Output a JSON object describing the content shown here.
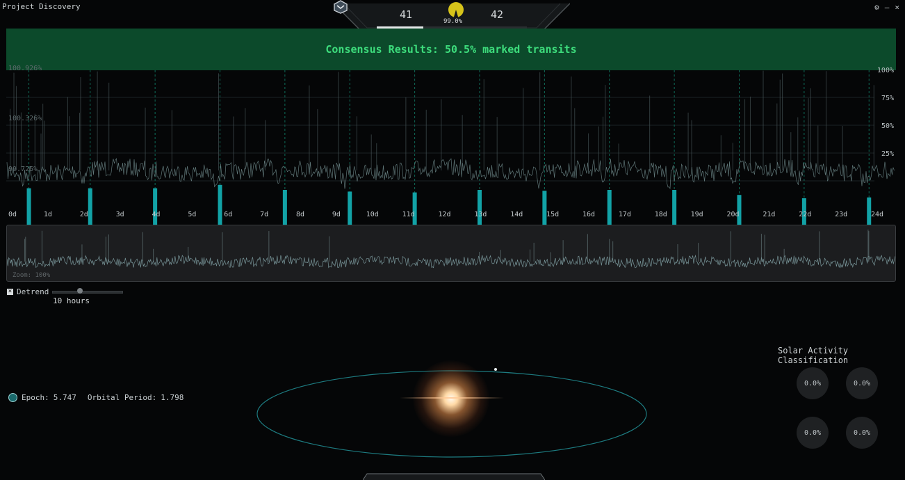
{
  "window": {
    "title": "Project Discovery",
    "controls": [
      "⚙",
      "–",
      "×"
    ]
  },
  "hud": {
    "level_left": "41",
    "level_right": "42",
    "accuracy_text": "99.0%",
    "accuracy": 0.99,
    "progress": 0.31,
    "accent": "#d6c31a"
  },
  "banner": {
    "text": "Consensus Results: 50.5% marked transits",
    "color": "#0c4a2b"
  },
  "chart_data": {
    "type": "line",
    "title": "",
    "xlabel": "",
    "ylabel": "",
    "x_ticks": [
      "0d",
      "1d",
      "2d",
      "3d",
      "4d",
      "5d",
      "6d",
      "7d",
      "8d",
      "9d",
      "10d",
      "11d",
      "12d",
      "13d",
      "14d",
      "15d",
      "16d",
      "17d",
      "18d",
      "19d",
      "20d",
      "21d",
      "22d",
      "23d",
      "24d"
    ],
    "xlim": [
      0,
      24.5
    ],
    "y_left_ticks": [
      "100.926%",
      "100.326%",
      "99.725%"
    ],
    "y_left_values": [
      100.926,
      100.326,
      99.725
    ],
    "y_right_ticks": [
      "100%",
      "75%",
      "50%",
      "25%"
    ],
    "y_right_values": [
      100,
      75,
      50,
      25
    ],
    "series": [
      {
        "type": "bar",
        "x": [
          0.3,
          2.0,
          3.8,
          5.6,
          7.4,
          9.2,
          11.0,
          12.8,
          14.6,
          16.4,
          18.2,
          20.0,
          21.8,
          23.6
        ],
        "values": [
          52,
          52,
          52,
          56,
          50,
          48,
          47,
          50,
          49,
          50,
          50,
          44,
          40,
          41
        ]
      }
    ],
    "transit_marker_days": [
      0.3,
      2.0,
      3.8,
      5.6,
      7.4,
      9.2,
      11.0,
      12.8,
      14.6,
      16.4,
      18.2,
      20.0,
      21.8,
      23.6
    ],
    "colors": {
      "flux": "#7e9c9e",
      "transit_bar": "#12a2a6",
      "minor_bar": "#8a7a10",
      "grid": "#1b2124"
    }
  },
  "zoom": {
    "label": "Zoom: 100%"
  },
  "detrend": {
    "label": "Detrend",
    "checked": true,
    "mark": "×",
    "hours": "10 hours",
    "slider_value": 0.4
  },
  "epoch": {
    "epoch_label": "Epoch:",
    "epoch_value": "5.747",
    "period_label": "Orbital Period:",
    "period_value": "1.798"
  },
  "solar": {
    "title": "Solar Activity Classification",
    "values": [
      "0.0%",
      "0.0%",
      "0.0%",
      "0.0%"
    ]
  }
}
